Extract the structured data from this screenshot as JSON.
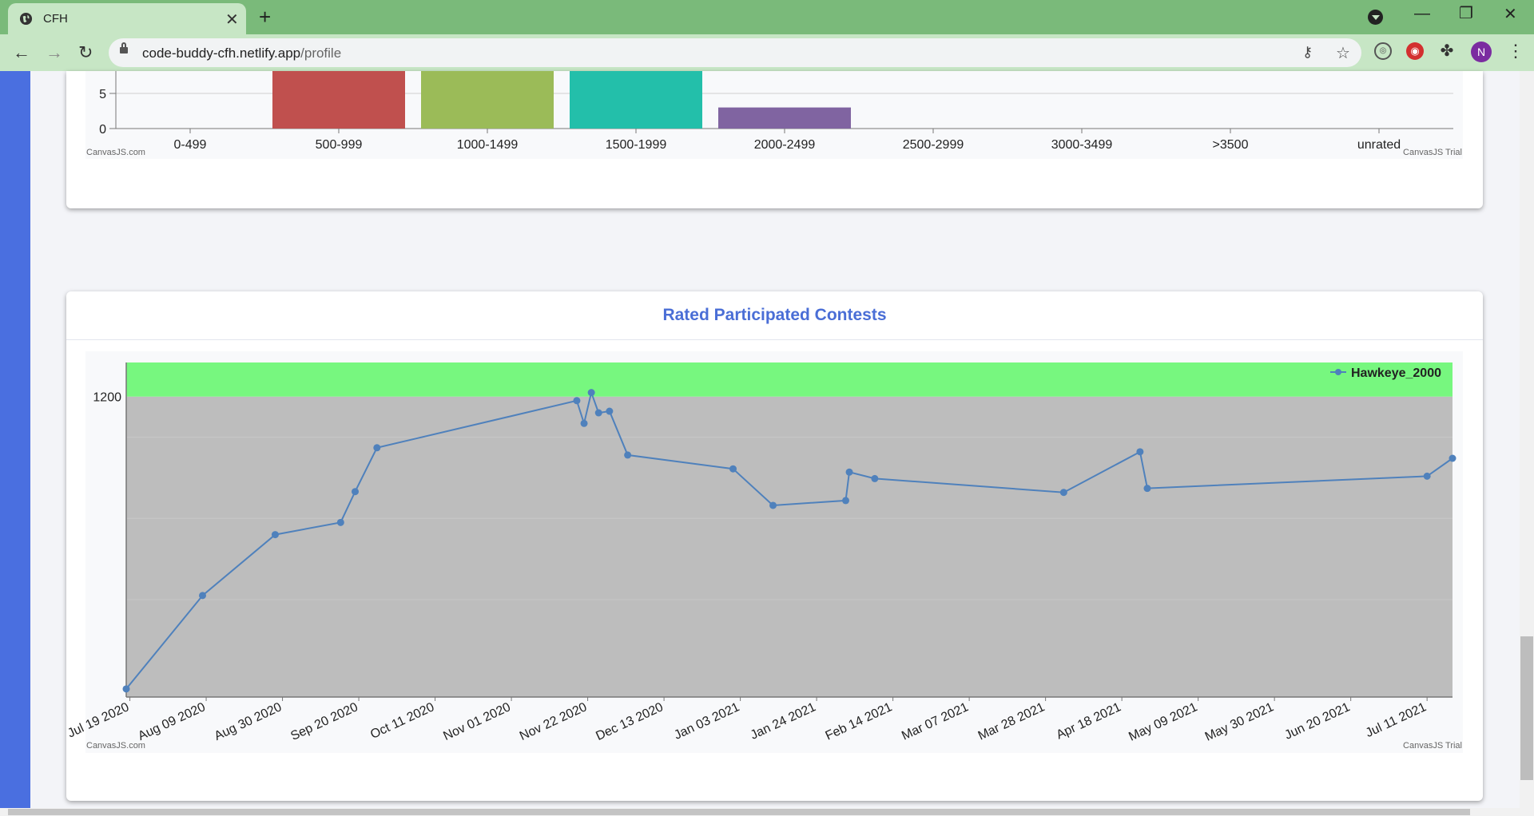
{
  "browser": {
    "tab_title": "CFH",
    "url_host": "code-buddy-cfh.netlify.app",
    "url_path": "/profile",
    "avatar_letter": "N"
  },
  "chart_data": [
    {
      "type": "bar",
      "categories": [
        "0-499",
        "500-999",
        "1000-1499",
        "1500-1999",
        "2000-2499",
        "2500-2999",
        "3000-3499",
        ">3500",
        "unrated"
      ],
      "values": [
        0,
        20,
        20,
        20,
        3,
        0,
        0,
        0,
        0
      ],
      "colors": [
        "#4f81bc",
        "#c0504e",
        "#9bbb58",
        "#23bfaa",
        "#8064a1",
        "#4aacc5",
        "#f79647",
        "#7f6084",
        "#77a033"
      ],
      "visible_yticks": [
        0,
        5
      ],
      "grid": true,
      "watermark_left": "CanvasJS.com",
      "watermark_right": "CanvasJS Trial"
    },
    {
      "type": "line",
      "title": "Rated Participated Contests",
      "series": [
        {
          "name": "Hawkeye_2000",
          "color": "#4f81bc",
          "points": [
            [
              "2020-07-18",
              840
            ],
            [
              "2020-08-08",
              955
            ],
            [
              "2020-08-28",
              1030
            ],
            [
              "2020-09-15",
              1045
            ],
            [
              "2020-09-19",
              1083
            ],
            [
              "2020-09-25",
              1137
            ],
            [
              "2020-11-19",
              1195
            ],
            [
              "2020-11-21",
              1167
            ],
            [
              "2020-11-23",
              1205
            ],
            [
              "2020-11-25",
              1180
            ],
            [
              "2020-11-28",
              1182
            ],
            [
              "2020-12-03",
              1128
            ],
            [
              "2021-01-01",
              1111
            ],
            [
              "2021-01-12",
              1066
            ],
            [
              "2021-02-01",
              1072
            ],
            [
              "2021-02-02",
              1107
            ],
            [
              "2021-02-09",
              1099
            ],
            [
              "2021-04-02",
              1082
            ],
            [
              "2021-04-23",
              1132
            ],
            [
              "2021-04-25",
              1087
            ],
            [
              "2021-07-11",
              1102
            ],
            [
              "2021-07-18",
              1124
            ]
          ]
        }
      ],
      "x_tick_labels": [
        "Jul 19 2020",
        "Aug 09 2020",
        "Aug 30 2020",
        "Sep 20 2020",
        "Oct 11 2020",
        "Nov 01 2020",
        "Nov 22 2020",
        "Dec 13 2020",
        "Jan 03 2021",
        "Jan 24 2021",
        "Feb 14 2021",
        "Mar 07 2021",
        "Mar 28 2021",
        "Apr 18 2021",
        "May 09 2021",
        "May 30 2021",
        "Jun 20 2021",
        "Jul 11 2021"
      ],
      "x_range": [
        "2020-07-18",
        "2021-07-18"
      ],
      "ylim": [
        830,
        1242
      ],
      "y_tick_labels": [
        1200
      ],
      "bands": [
        {
          "from": 830,
          "to": 1200,
          "color": "#bdbdbd"
        },
        {
          "from": 1200,
          "to": 1242,
          "color": "#77f77f"
        }
      ],
      "legend_position": "top-right",
      "watermark_left": "CanvasJS.com",
      "watermark_right": "CanvasJS Trial"
    }
  ]
}
